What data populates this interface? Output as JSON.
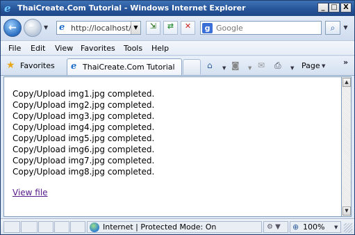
{
  "window": {
    "title": "ThaiCreate.Com Tutorial - Windows Internet Explorer",
    "controls": {
      "minimize": "_",
      "maximize": "□",
      "close": "X"
    }
  },
  "toolbar": {
    "back_glyph": "←",
    "forward_glyph": "→",
    "address_value": "http://localhost/r",
    "search_placeholder": "Google",
    "search_go_glyph": "⌕"
  },
  "menu": {
    "items": [
      "File",
      "Edit",
      "View",
      "Favorites",
      "Tools",
      "Help"
    ]
  },
  "favorites_bar": {
    "favorites_label": "Favorites",
    "tab_label": "ThaiCreate.Com Tutorial",
    "page_label": "Page",
    "overflow": "»"
  },
  "content": {
    "lines": [
      "Copy/Upload img1.jpg completed.",
      "Copy/Upload img2.jpg completed.",
      "Copy/Upload img3.jpg completed.",
      "Copy/Upload img4.jpg completed.",
      "Copy/Upload img5.jpg completed.",
      "Copy/Upload img6.jpg completed.",
      "Copy/Upload img7.jpg completed.",
      "Copy/Upload img8.jpg completed."
    ],
    "view_file_link": "View file"
  },
  "statusbar": {
    "zone_text": "Internet | Protected Mode: On",
    "zoom_text": "100%"
  },
  "icons": {
    "ie": "ie-logo-icon",
    "star": "favorites-star-icon",
    "home": "home-icon",
    "feeds": "feeds-icon",
    "mail": "mail-icon",
    "print": "print-icon",
    "globe": "internet-zone-icon",
    "zoom": "zoom-icon"
  },
  "colors": {
    "titlebar": "#27559a",
    "link_visited": "#551a8b",
    "stop": "#c8201e",
    "refresh": "#2d8f3a"
  }
}
